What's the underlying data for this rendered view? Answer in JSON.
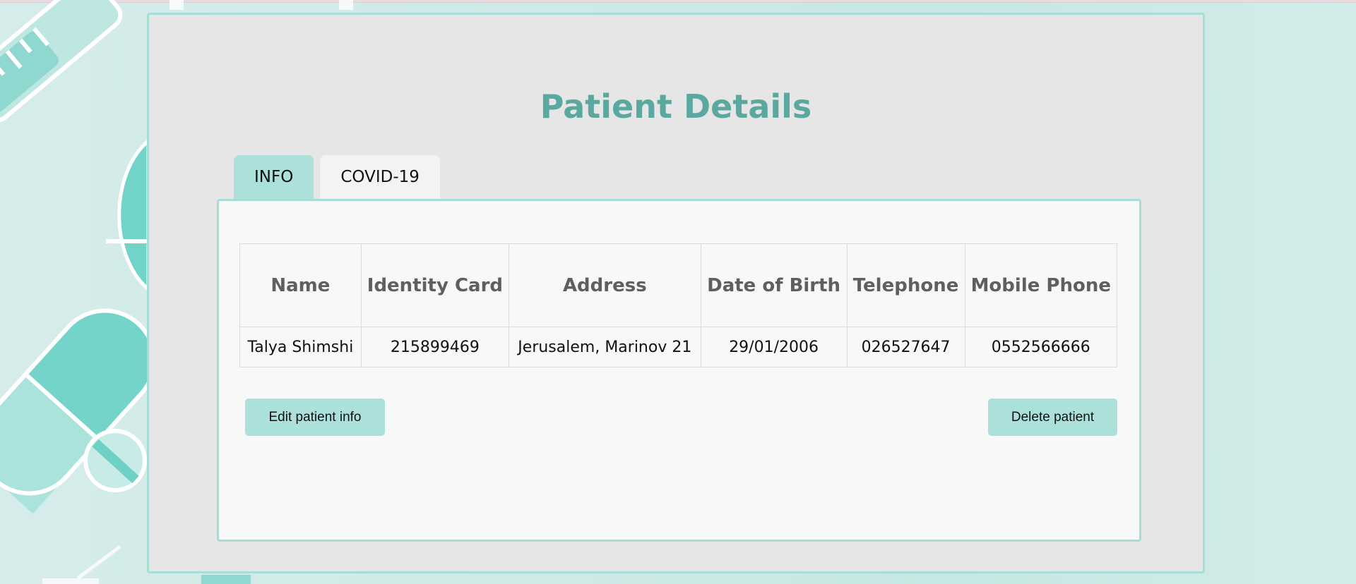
{
  "page": {
    "title": "Patient Details"
  },
  "tabs": [
    {
      "label": "INFO",
      "active": true
    },
    {
      "label": "COVID-19",
      "active": false
    }
  ],
  "table": {
    "headers": [
      "Name",
      "Identity Card",
      "Address",
      "Date of Birth",
      "Telephone",
      "Mobile Phone"
    ],
    "rows": [
      [
        "Talya Shimshi",
        "215899469",
        "Jerusalem, Marinov 21",
        "29/01/2006",
        "026527647",
        "0552566666"
      ]
    ]
  },
  "actions": {
    "edit_label": "Edit patient info",
    "delete_label": "Delete patient"
  },
  "colors": {
    "accent": "#abe0db",
    "border": "#a6ddd6",
    "title": "#5aa8a0",
    "panel_bg": "#e6e6e6",
    "content_bg": "#f8f8f8"
  },
  "icons": [
    "syringe-illustration",
    "pill-capsule-illustration",
    "tablet-illustration"
  ]
}
